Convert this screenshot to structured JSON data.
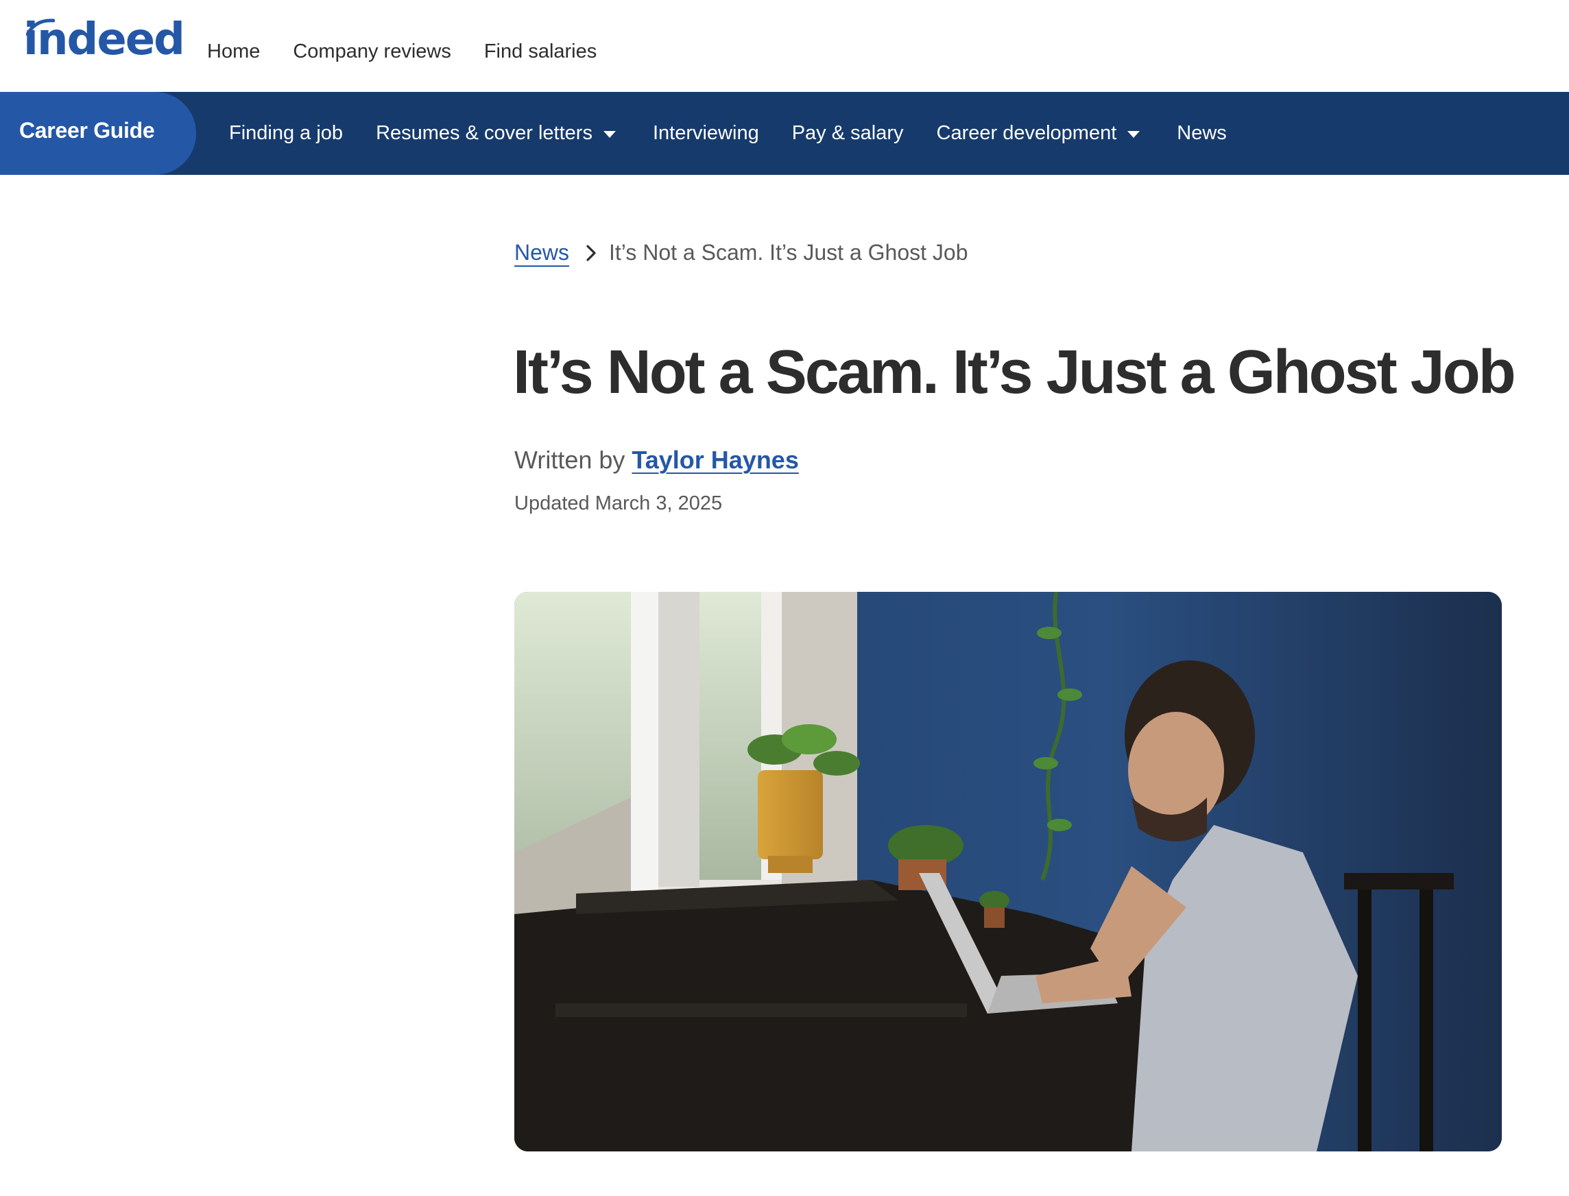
{
  "header": {
    "logo_text": "indeed",
    "nav": [
      "Home",
      "Company reviews",
      "Find salaries"
    ]
  },
  "career_nav": {
    "brand": "Career Guide",
    "items": [
      {
        "label": "Finding a job",
        "dropdown": false
      },
      {
        "label": "Resumes & cover letters",
        "dropdown": true
      },
      {
        "label": "Interviewing",
        "dropdown": false
      },
      {
        "label": "Pay & salary",
        "dropdown": false
      },
      {
        "label": "Career development",
        "dropdown": true
      },
      {
        "label": "News",
        "dropdown": false
      }
    ]
  },
  "breadcrumb": {
    "parent": "News",
    "current": "It’s Not a Scam. It’s Just a Ghost Job"
  },
  "article": {
    "title": "It’s Not a Scam. It’s Just a Ghost Job",
    "byline_prefix": "Written by",
    "author": "Taylor Haynes",
    "updated": "Updated March 3, 2025"
  },
  "colors": {
    "brand_blue": "#2557a7",
    "nav_dark": "#163a6b",
    "text": "#2d2d2d",
    "muted": "#595959"
  }
}
